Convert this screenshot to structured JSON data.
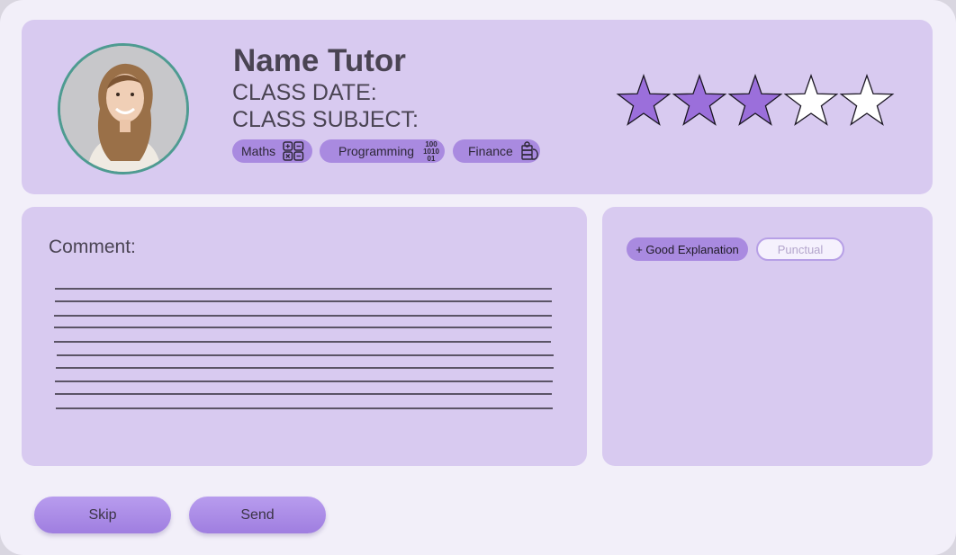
{
  "header": {
    "name": "Name Tutor",
    "class_date_label": "CLASS DATE:",
    "class_subject_label": "CLASS SUBJECT:",
    "avatar_alt": "",
    "subjects": [
      {
        "label": "Maths",
        "icon": "calculator-icon"
      },
      {
        "label": "Programming",
        "icon": "binary-code-icon"
      },
      {
        "label": "Finance",
        "icon": "money-stack-icon"
      }
    ]
  },
  "rating": {
    "value": 3,
    "max": 5,
    "filled_color": "#9b6fdb",
    "empty_color": "#ffffff"
  },
  "comment": {
    "label": "Comment:",
    "line_count": 10
  },
  "feedback_tags": [
    {
      "label": "+ Good Explanation",
      "selected": true
    },
    {
      "label": "Punctual",
      "selected": false
    }
  ],
  "actions": {
    "skip_label": "Skip",
    "send_label": "Send"
  },
  "colors": {
    "background": "#f2eff9",
    "card": "#d8caf0",
    "accent": "#a98ae0",
    "text": "#4a4453",
    "avatar_border": "#4e9b91"
  }
}
